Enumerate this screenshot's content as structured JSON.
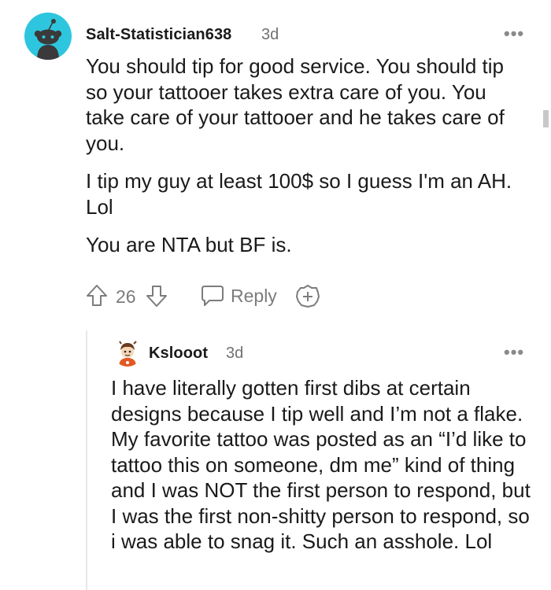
{
  "comment": {
    "username": "Salt-Statistician638",
    "age": "3d",
    "more": "•••",
    "paragraphs": [
      "You should tip for good service. You should tip so your tattooer takes extra care of you. You take care of your tattooer and he takes care of you.",
      "I tip my guy at least 100$ so I guess I'm an AH. Lol",
      "You are NTA but BF is."
    ],
    "votes": "26",
    "reply_label": "Reply",
    "avatar_icon": "reddit-snoo-avatar-icon",
    "accent": "#2ec6de"
  },
  "reply": {
    "username": "Kslooot",
    "age": "3d",
    "more": "•••",
    "text": "I have literally gotten first dibs at certain designs because I tip well and I’m not a flake. My favorite tattoo was posted as an “I’d like to tattoo this on someone, dm me” kind of thing and I was NOT the first person to respond, but I was the first non-shitty person to respond, so i was able to snag it. Such an asshole. Lol",
    "avatar_icon": "cartoon-avatar-icon"
  }
}
